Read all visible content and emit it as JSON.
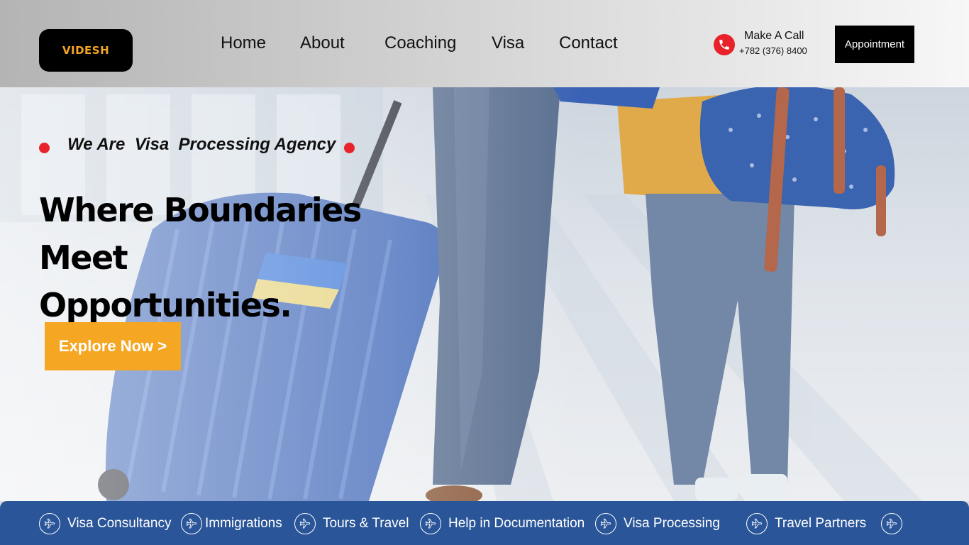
{
  "brand": {
    "logo_text": "VIDESH"
  },
  "nav": {
    "items": [
      {
        "label": "Home"
      },
      {
        "label": "About"
      },
      {
        "label": "Coaching"
      },
      {
        "label": "Visa"
      },
      {
        "label": "Contact"
      }
    ]
  },
  "contact": {
    "title": "Make A Call",
    "phone": "+782 (376) 8400",
    "icon": "phone-icon"
  },
  "appointment_button": {
    "label": "Appointment"
  },
  "hero": {
    "tagline": "We Are  Visa  Processing Agency",
    "headline_line1": "Where Boundaries Meet",
    "headline_line2": "Opportunities.",
    "cta_label": "Explore Now >"
  },
  "services": {
    "items": [
      {
        "label": "Visa Consultancy",
        "icon": "airplane-icon"
      },
      {
        "label": "Immigrations",
        "icon": "airplane-icon"
      },
      {
        "label": "Tours & Travel",
        "icon": "airplane-icon"
      },
      {
        "label": "Help in Documentation",
        "icon": "airplane-icon"
      },
      {
        "label": "Visa Processing",
        "icon": "airplane-icon"
      },
      {
        "label": "Travel Partners",
        "icon": "airplane-icon"
      }
    ]
  },
  "colors": {
    "accent": "#f5a623",
    "dot_red": "#e8222a",
    "service_bar": "#2a5598",
    "dark": "#000000"
  }
}
